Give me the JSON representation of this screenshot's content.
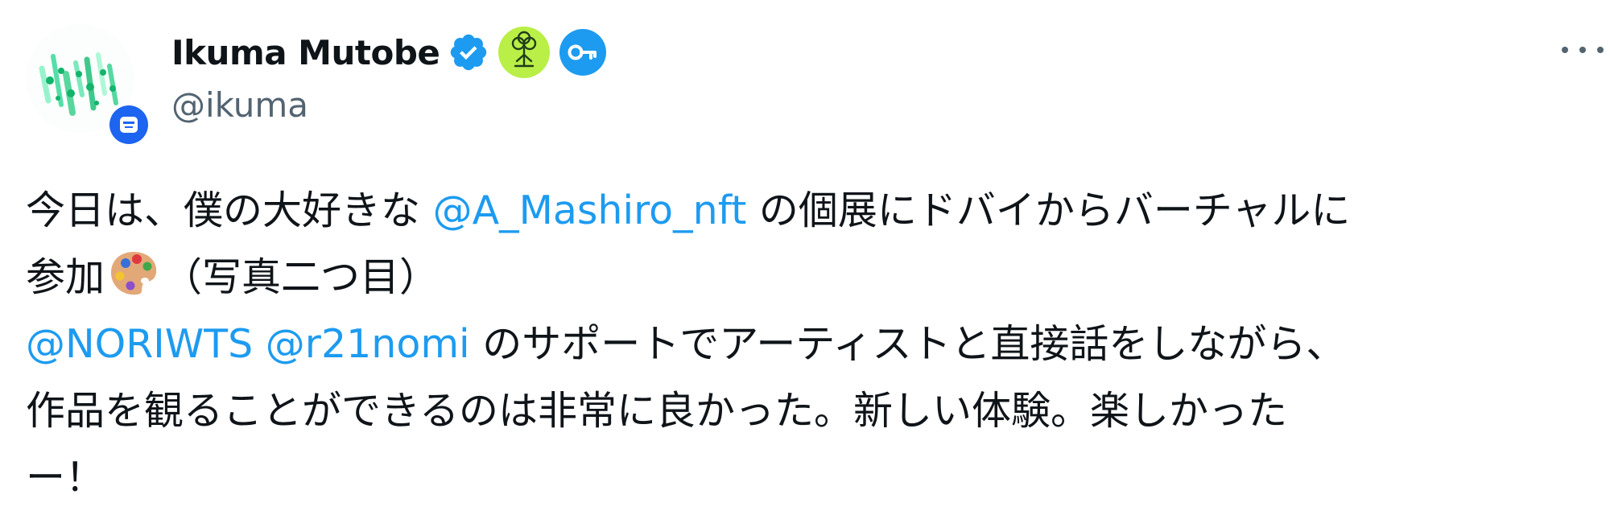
{
  "author": {
    "name": "Ikuma Mutobe",
    "handle": "@ikuma",
    "verified_icon": "verified-check-icon",
    "badges": [
      "tree-affiliate-badge-icon",
      "key-badge-icon"
    ],
    "avatar_badge_icon": "nft-face-badge-icon"
  },
  "colors": {
    "mention": "#1d9bf0",
    "verified": "#1d9bf0",
    "text": "#0f1419",
    "secondary": "#536471"
  },
  "tweet": {
    "line1_pre": "今日は、僕の大好きな ",
    "mention1": "@A_Mashiro_nft",
    "line1_post": " の個展にドバイからバーチャルに",
    "line2_pre": "参加",
    "emoji": "artist-palette-emoji",
    "line2_post": "（写真二つ目）",
    "mention2": "@NORIWTS",
    "mention3": "@r21nomi",
    "line3_post": " のサポートでアーティストと直接話をしながら、",
    "line4": "作品を観ることができるのは非常に良かった。新しい体験。楽しかった",
    "line5": "ー！"
  },
  "more_icon": "more-options-icon"
}
